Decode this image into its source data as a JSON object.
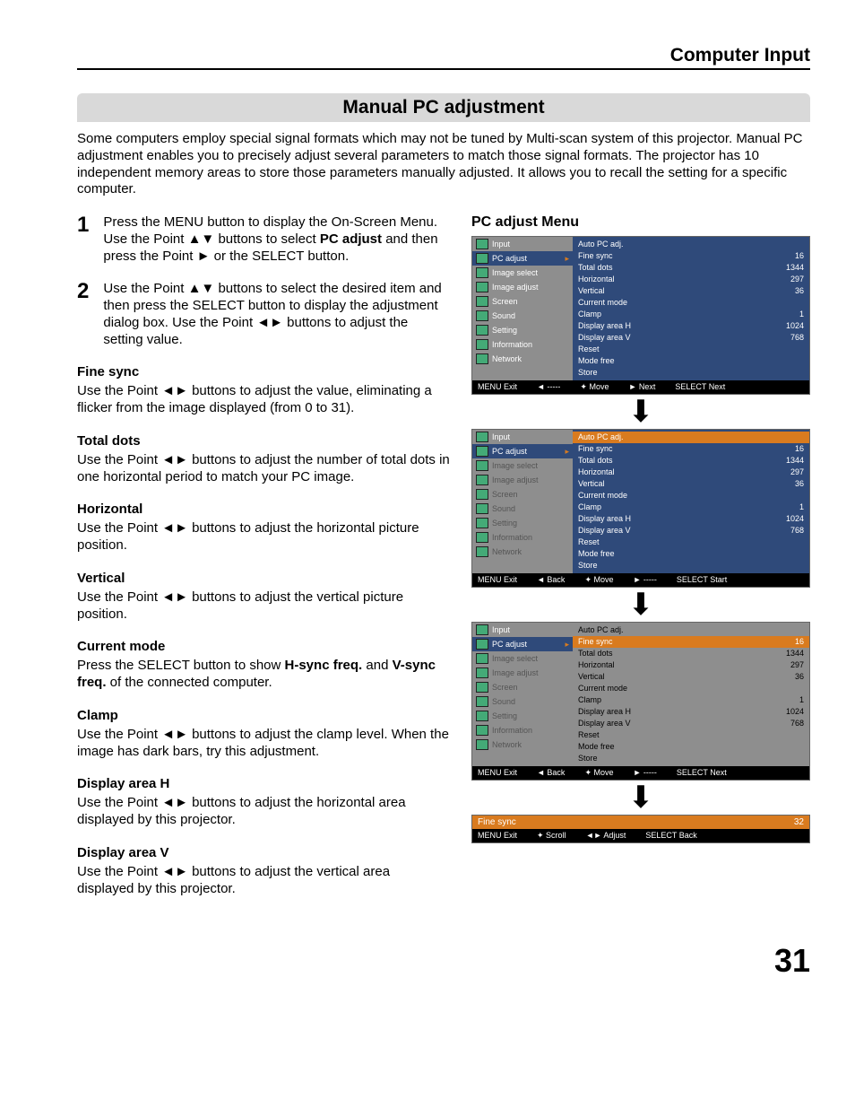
{
  "header": "Computer Input",
  "title": "Manual PC adjustment",
  "intro": "Some computers employ special signal formats which may not be tuned by Multi-scan system of this projector. Manual PC adjustment enables you to precisely adjust several parameters to match those signal formats. The projector has 10 independent memory areas to store those parameters manually adjusted. It allows you to recall the setting for a specific computer.",
  "steps": [
    {
      "num": "1",
      "a": "Press the MENU button to display the On-Screen Menu. Use the Point ▲▼ buttons to select ",
      "b": "PC adjust",
      "c": " and then press the Point ► or the SELECT button."
    },
    {
      "num": "2",
      "a": "Use the Point ▲▼ buttons to select  the desired item and then press the SELECT button to display the adjustment dialog box. Use the Point ◄► buttons to adjust the setting value.",
      "b": "",
      "c": ""
    }
  ],
  "sections": [
    {
      "h": "Fine sync",
      "p": "Use the Point ◄► buttons to adjust the value, eliminating a flicker from the image displayed (from 0 to 31)."
    },
    {
      "h": "Total dots",
      "p": "Use the Point ◄► buttons to adjust the number of total dots in one horizontal period to match your PC image."
    },
    {
      "h": "Horizontal",
      "p": "Use the Point ◄► buttons to adjust the horizontal picture position."
    },
    {
      "h": "Vertical",
      "p": "Use the Point ◄► buttons to adjust the vertical picture position."
    },
    {
      "h": "Current mode",
      "p_a": "Press the SELECT button to show ",
      "p_b": "H-sync freq.",
      "p_c": " and ",
      "p_d": "V-sync freq.",
      "p_e": " of the connected computer."
    },
    {
      "h": "Clamp",
      "p": "Use the Point ◄► buttons to adjust the clamp level. When the image has dark bars, try this adjustment."
    },
    {
      "h": "Display area H",
      "p": "Use the Point ◄► buttons to adjust the horizontal area displayed by this projector."
    },
    {
      "h": "Display area V",
      "p": "Use the Point ◄► buttons to adjust the vertical area displayed by this projector."
    }
  ],
  "pc_title": "PC adjust Menu",
  "menu_items": [
    "Input",
    "PC adjust",
    "Image select",
    "Image adjust",
    "Screen",
    "Sound",
    "Setting",
    "Information",
    "Network"
  ],
  "val_rows": [
    {
      "l": "Auto PC adj.",
      "v": ""
    },
    {
      "l": "Fine sync",
      "v": "16"
    },
    {
      "l": "Total dots",
      "v": "1344"
    },
    {
      "l": "Horizontal",
      "v": "297"
    },
    {
      "l": "Vertical",
      "v": "36"
    },
    {
      "l": "Current mode",
      "v": ""
    },
    {
      "l": "Clamp",
      "v": "1"
    },
    {
      "l": "Display area H",
      "v": "1024"
    },
    {
      "l": "Display area V",
      "v": "768"
    },
    {
      "l": "Reset",
      "v": ""
    },
    {
      "l": "Mode free",
      "v": ""
    },
    {
      "l": "Store",
      "v": ""
    }
  ],
  "status": {
    "p1": [
      "MENU Exit",
      "◄ -----",
      "✦ Move",
      "► Next",
      "SELECT Next"
    ],
    "p2": [
      "MENU Exit",
      "◄ Back",
      "✦ Move",
      "► -----",
      "SELECT Start"
    ],
    "p3": [
      "MENU Exit",
      "◄ Back",
      "✦ Move",
      "► -----",
      "SELECT Next"
    ],
    "adj": [
      "MENU Exit",
      "✦ Scroll",
      "◄► Adjust",
      "SELECT Back"
    ]
  },
  "adj": {
    "label": "Fine sync",
    "value": "32"
  },
  "page_num": "31"
}
